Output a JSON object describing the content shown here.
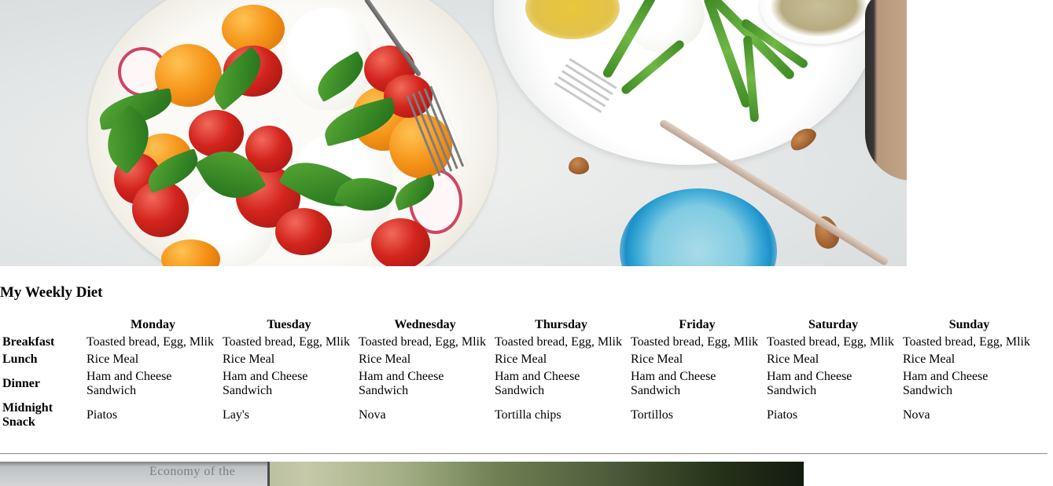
{
  "hero_image": {
    "alt_subject": "food-photo"
  },
  "heading": "My Weekly Diet",
  "table": {
    "corner": "",
    "days": [
      "Monday",
      "Tuesday",
      "Wednesday",
      "Thursday",
      "Friday",
      "Saturday",
      "Sunday"
    ],
    "rows": [
      {
        "meal": "Breakfast",
        "items": [
          "Toasted bread, Egg, Mlik",
          "Toasted bread, Egg, Mlik",
          "Toasted bread, Egg, Mlik",
          "Toasted bread, Egg, Mlik",
          "Toasted bread, Egg, Mlik",
          "Toasted bread, Egg, Mlik",
          "Toasted bread, Egg, Mlik"
        ]
      },
      {
        "meal": "Lunch",
        "items": [
          "Rice Meal",
          "Rice Meal",
          "Rice Meal",
          "Rice Meal",
          "Rice Meal",
          "Rice Meal",
          "Rice Meal"
        ]
      },
      {
        "meal": "Dinner",
        "items": [
          "Ham and Cheese Sandwich",
          "Ham and Cheese Sandwich",
          "Ham and Cheese Sandwich",
          "Ham and Cheese Sandwich",
          "Ham and Cheese Sandwich",
          "Ham and Cheese Sandwich",
          "Ham and Cheese Sandwich"
        ]
      },
      {
        "meal": "Midnight Snack",
        "items": [
          "Piatos",
          "Lay's",
          "Nova",
          "Tortilla chips",
          "Tortillos",
          "Piatos",
          "Nova"
        ]
      }
    ]
  },
  "bottom_image": {
    "visible_text": "Economy of the"
  },
  "colors": {
    "background": "#ffffff",
    "text": "#000000",
    "divider": "#9a9a9a"
  }
}
